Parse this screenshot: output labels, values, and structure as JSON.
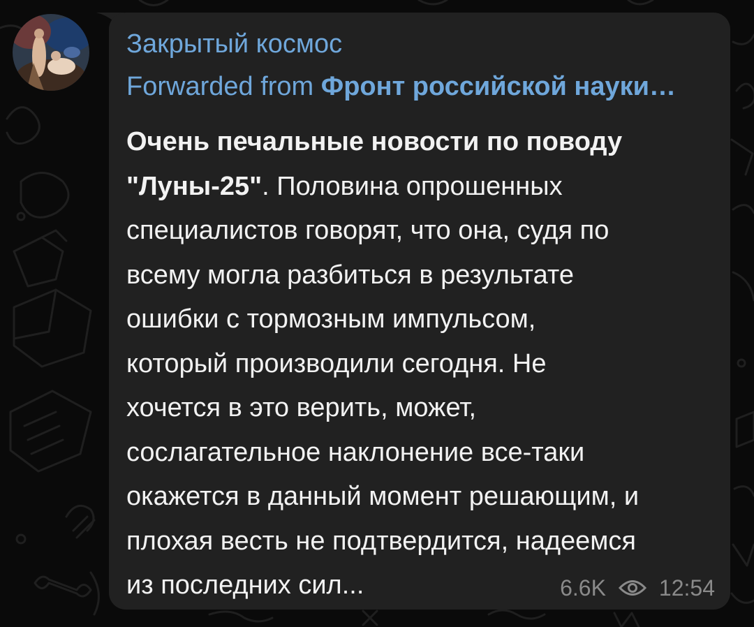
{
  "channel": {
    "name": "Закрытый космос",
    "avatar_icon": "channel-avatar-painting"
  },
  "forward": {
    "prefix": "Forwarded from",
    "source": "Фронт российской науки…"
  },
  "message": {
    "lines": [
      {
        "bold": "Очень печальные новости по поводу",
        "text": ""
      },
      {
        "bold": "\"Луны-25\"",
        "text": ". Половина опрошенных"
      },
      {
        "bold": "",
        "text": "специалистов говорят, что она, судя по"
      },
      {
        "bold": "",
        "text": "всему могла разбиться в результате"
      },
      {
        "bold": "",
        "text": "ошибки с тормозным импульсом,"
      },
      {
        "bold": "",
        "text": "который производили сегодня. Не"
      },
      {
        "bold": "",
        "text": "хочется в это верить, может,"
      },
      {
        "bold": "",
        "text": "сослагательное наклонение все-таки"
      },
      {
        "bold": "",
        "text": "окажется в данный момент решающим, и"
      },
      {
        "bold": "",
        "text": "плохая весть не подтвердится, надеемся"
      },
      {
        "bold": "",
        "text": "из последних сил..."
      }
    ]
  },
  "meta": {
    "views": "6.6K",
    "views_icon": "eye-icon",
    "time": "12:54"
  },
  "colors": {
    "background": "#0a0a0a",
    "bubble": "#212121",
    "accent": "#6fa7db",
    "text": "#f2f2f2",
    "meta": "#8a8a8a"
  }
}
